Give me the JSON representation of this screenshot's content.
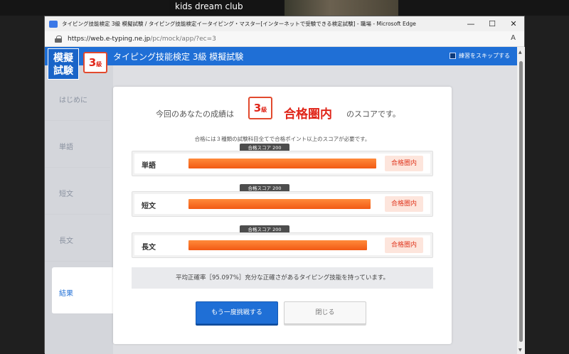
{
  "call": {
    "participant_label": "kids dream club"
  },
  "browser": {
    "title": "タイピング技能検定 3級 模擬試験 / タイピング技能検定イータイピング・マスター[インターネットで受験できる検定試験] - 職場 - Microsoft Edge",
    "url_host": "https://web.e-typing.ne.jp",
    "url_path": "/pc/mock/app/?ec=3",
    "controls": {
      "minimize": "—",
      "maximize": "☐",
      "close": "✕"
    }
  },
  "header": {
    "logo_line1": "模擬",
    "logo_line2": "試験",
    "grade_num": "3",
    "grade_suffix": "級",
    "title": "タイピング技能検定 3級 模擬試験",
    "skip_label": "練習をスキップする"
  },
  "sidebar": {
    "items": [
      {
        "label": "はじめに",
        "active": false
      },
      {
        "label": "単語",
        "active": false
      },
      {
        "label": "短文",
        "active": false
      },
      {
        "label": "長文",
        "active": false
      },
      {
        "label": "結果",
        "active": true
      }
    ]
  },
  "result": {
    "score_pre": "今回のあなたの成績は",
    "grade_num": "3",
    "grade_suffix": "級",
    "status": "合格圏内",
    "score_post": "のスコアです。",
    "note": "合格には３種類の試験科目全てで合格ポイント以上のスコアが必要です。",
    "pass_tag": "合格スコア 200",
    "rows": [
      {
        "label": "単語",
        "fill": 1.0,
        "status": "合格圏内"
      },
      {
        "label": "短文",
        "fill": 0.97,
        "status": "合格圏内"
      },
      {
        "label": "長文",
        "fill": 0.95,
        "status": "合格圏内"
      }
    ],
    "accuracy": "平均正確率［95.097%］充分な正確さがあるタイピング技能を持っています。",
    "retry_label": "もう一度挑戦する",
    "close_label": "閉じる"
  },
  "colors": {
    "brand_blue": "#1f6fd6",
    "accent_red": "#e0261a",
    "bar_orange": "#f25a14"
  }
}
